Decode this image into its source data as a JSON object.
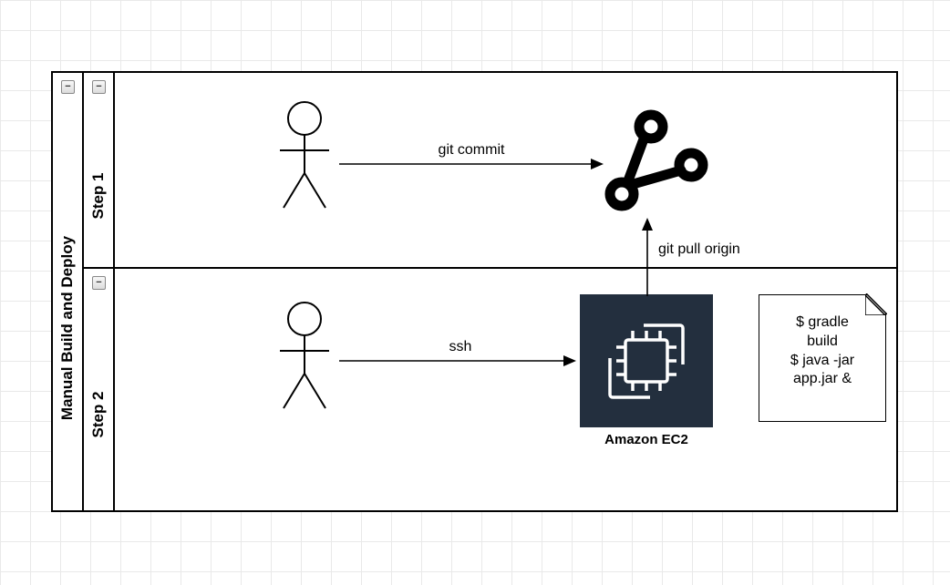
{
  "diagram": {
    "title": "Manual Build and Deploy",
    "lanes": [
      {
        "label": "Step 1"
      },
      {
        "label": "Step 2"
      }
    ],
    "arrows": {
      "git_commit": "git commit",
      "ssh": "ssh",
      "git_pull": "git pull origin"
    },
    "ec2_caption": "Amazon EC2",
    "note_lines": [
      "$ gradle",
      "build",
      "$ java -jar",
      "app.jar &"
    ],
    "collapse_glyph": "−"
  }
}
